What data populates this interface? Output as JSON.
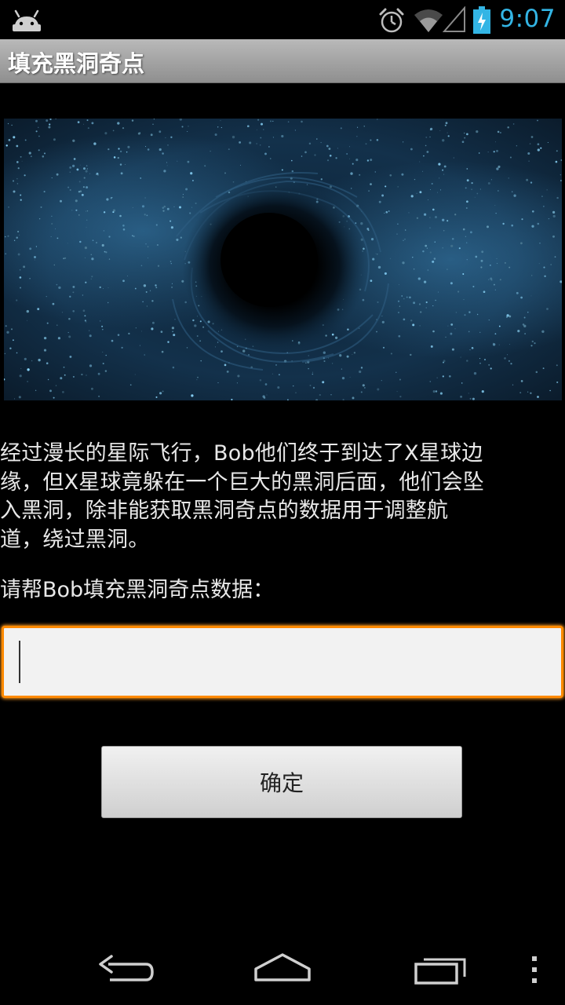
{
  "status_bar": {
    "time": "9:07",
    "icons": [
      "android-icon",
      "alarm-icon",
      "wifi-icon",
      "signal-icon",
      "battery-charging-icon"
    ],
    "accent_color": "#33b5e5"
  },
  "title_bar": {
    "title": "填充黑洞奇点"
  },
  "hero_image": {
    "subject": "black-hole-icon"
  },
  "content": {
    "story": "经过漫长的星际飞行，Bob他们终于到达了X星球边\n缘，但X星球竟躲在一个巨大的黑洞后面，他们会坠\n入黑洞，除非能获取黑洞奇点的数据用于调整航\n道，绕过黑洞。",
    "prompt": "请帮Bob填充黑洞奇点数据："
  },
  "input": {
    "value": "",
    "placeholder": "",
    "focus_color": "#ff8a00"
  },
  "button": {
    "label": "确定"
  },
  "nav_bar": {
    "buttons": [
      "back-icon",
      "home-icon",
      "recent-apps-icon",
      "menu-icon"
    ]
  }
}
